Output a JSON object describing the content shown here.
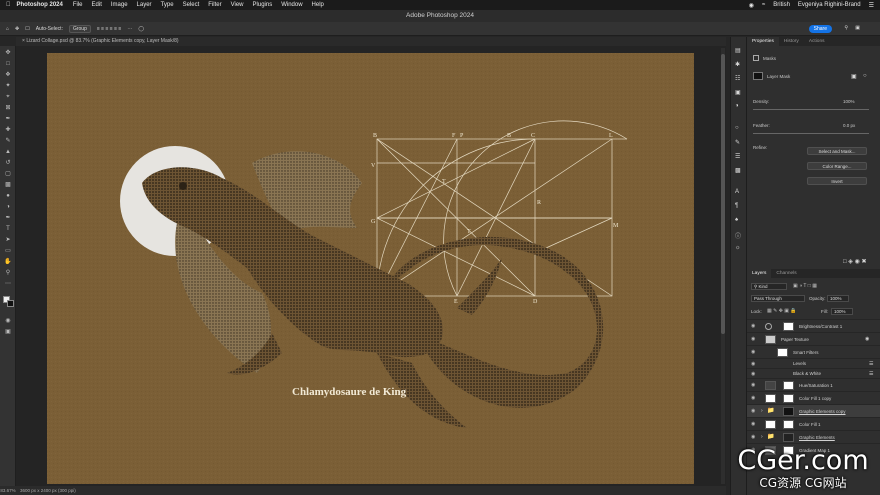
{
  "menubar": {
    "app": "Photoshop 2024",
    "items": [
      "File",
      "Edit",
      "Image",
      "Layer",
      "Type",
      "Select",
      "Filter",
      "View",
      "Plugins",
      "Window",
      "Help"
    ],
    "input_source": "British",
    "user": "Evgeniya Righini-Brand"
  },
  "window": {
    "title": "Adobe Photoshop 2024"
  },
  "options": {
    "auto_select": "Auto-Select:",
    "auto_select_target": "Group",
    "share": "Share"
  },
  "document": {
    "tab": "Lizard Collage.psd @ 83.7% (Graphic Elements copy, Layer Mask/8)",
    "zoom": "83.67%",
    "info": "3600 px x 2400 px (300 ppi)",
    "caption": "Chlamydosaure de King"
  },
  "properties": {
    "tabs": [
      "Properties",
      "History",
      "Actions"
    ],
    "section": "Masks",
    "mask_type": "Layer Mask",
    "density_label": "Density:",
    "density": "100%",
    "feather_label": "Feather:",
    "feather": "0.0 px",
    "refine_label": "Refine:",
    "select_mask": "Select and Mask...",
    "color_range": "Color Range...",
    "invert": "Invert"
  },
  "layers_panel": {
    "tabs": [
      "Layers",
      "Channels"
    ],
    "filter": "Kind",
    "blend_mode": "Pass Through",
    "opacity_label": "Opacity:",
    "opacity": "100%",
    "lock_label": "Lock:",
    "fill_label": "Fill:",
    "fill": "100%",
    "layers": [
      {
        "name": "Brightness/Contrast 1"
      },
      {
        "name": "Paper Texture"
      },
      {
        "name": "Smart Filters"
      },
      {
        "name": "Levels"
      },
      {
        "name": "Black & White"
      },
      {
        "name": "Hue/Saturation 1"
      },
      {
        "name": "Color Fill 1 copy"
      },
      {
        "name": "Graphic Elements copy"
      },
      {
        "name": "Color Fill 1"
      },
      {
        "name": "Graphic Elements"
      },
      {
        "name": "Gradient Map 1"
      }
    ]
  },
  "watermark": {
    "logo": "CGer.com",
    "sub": "CG资源 CG网站"
  },
  "colors": {
    "canvas_bg": "#7b5f36",
    "accent": "#1473e6",
    "diagram": "#efe6cf"
  }
}
